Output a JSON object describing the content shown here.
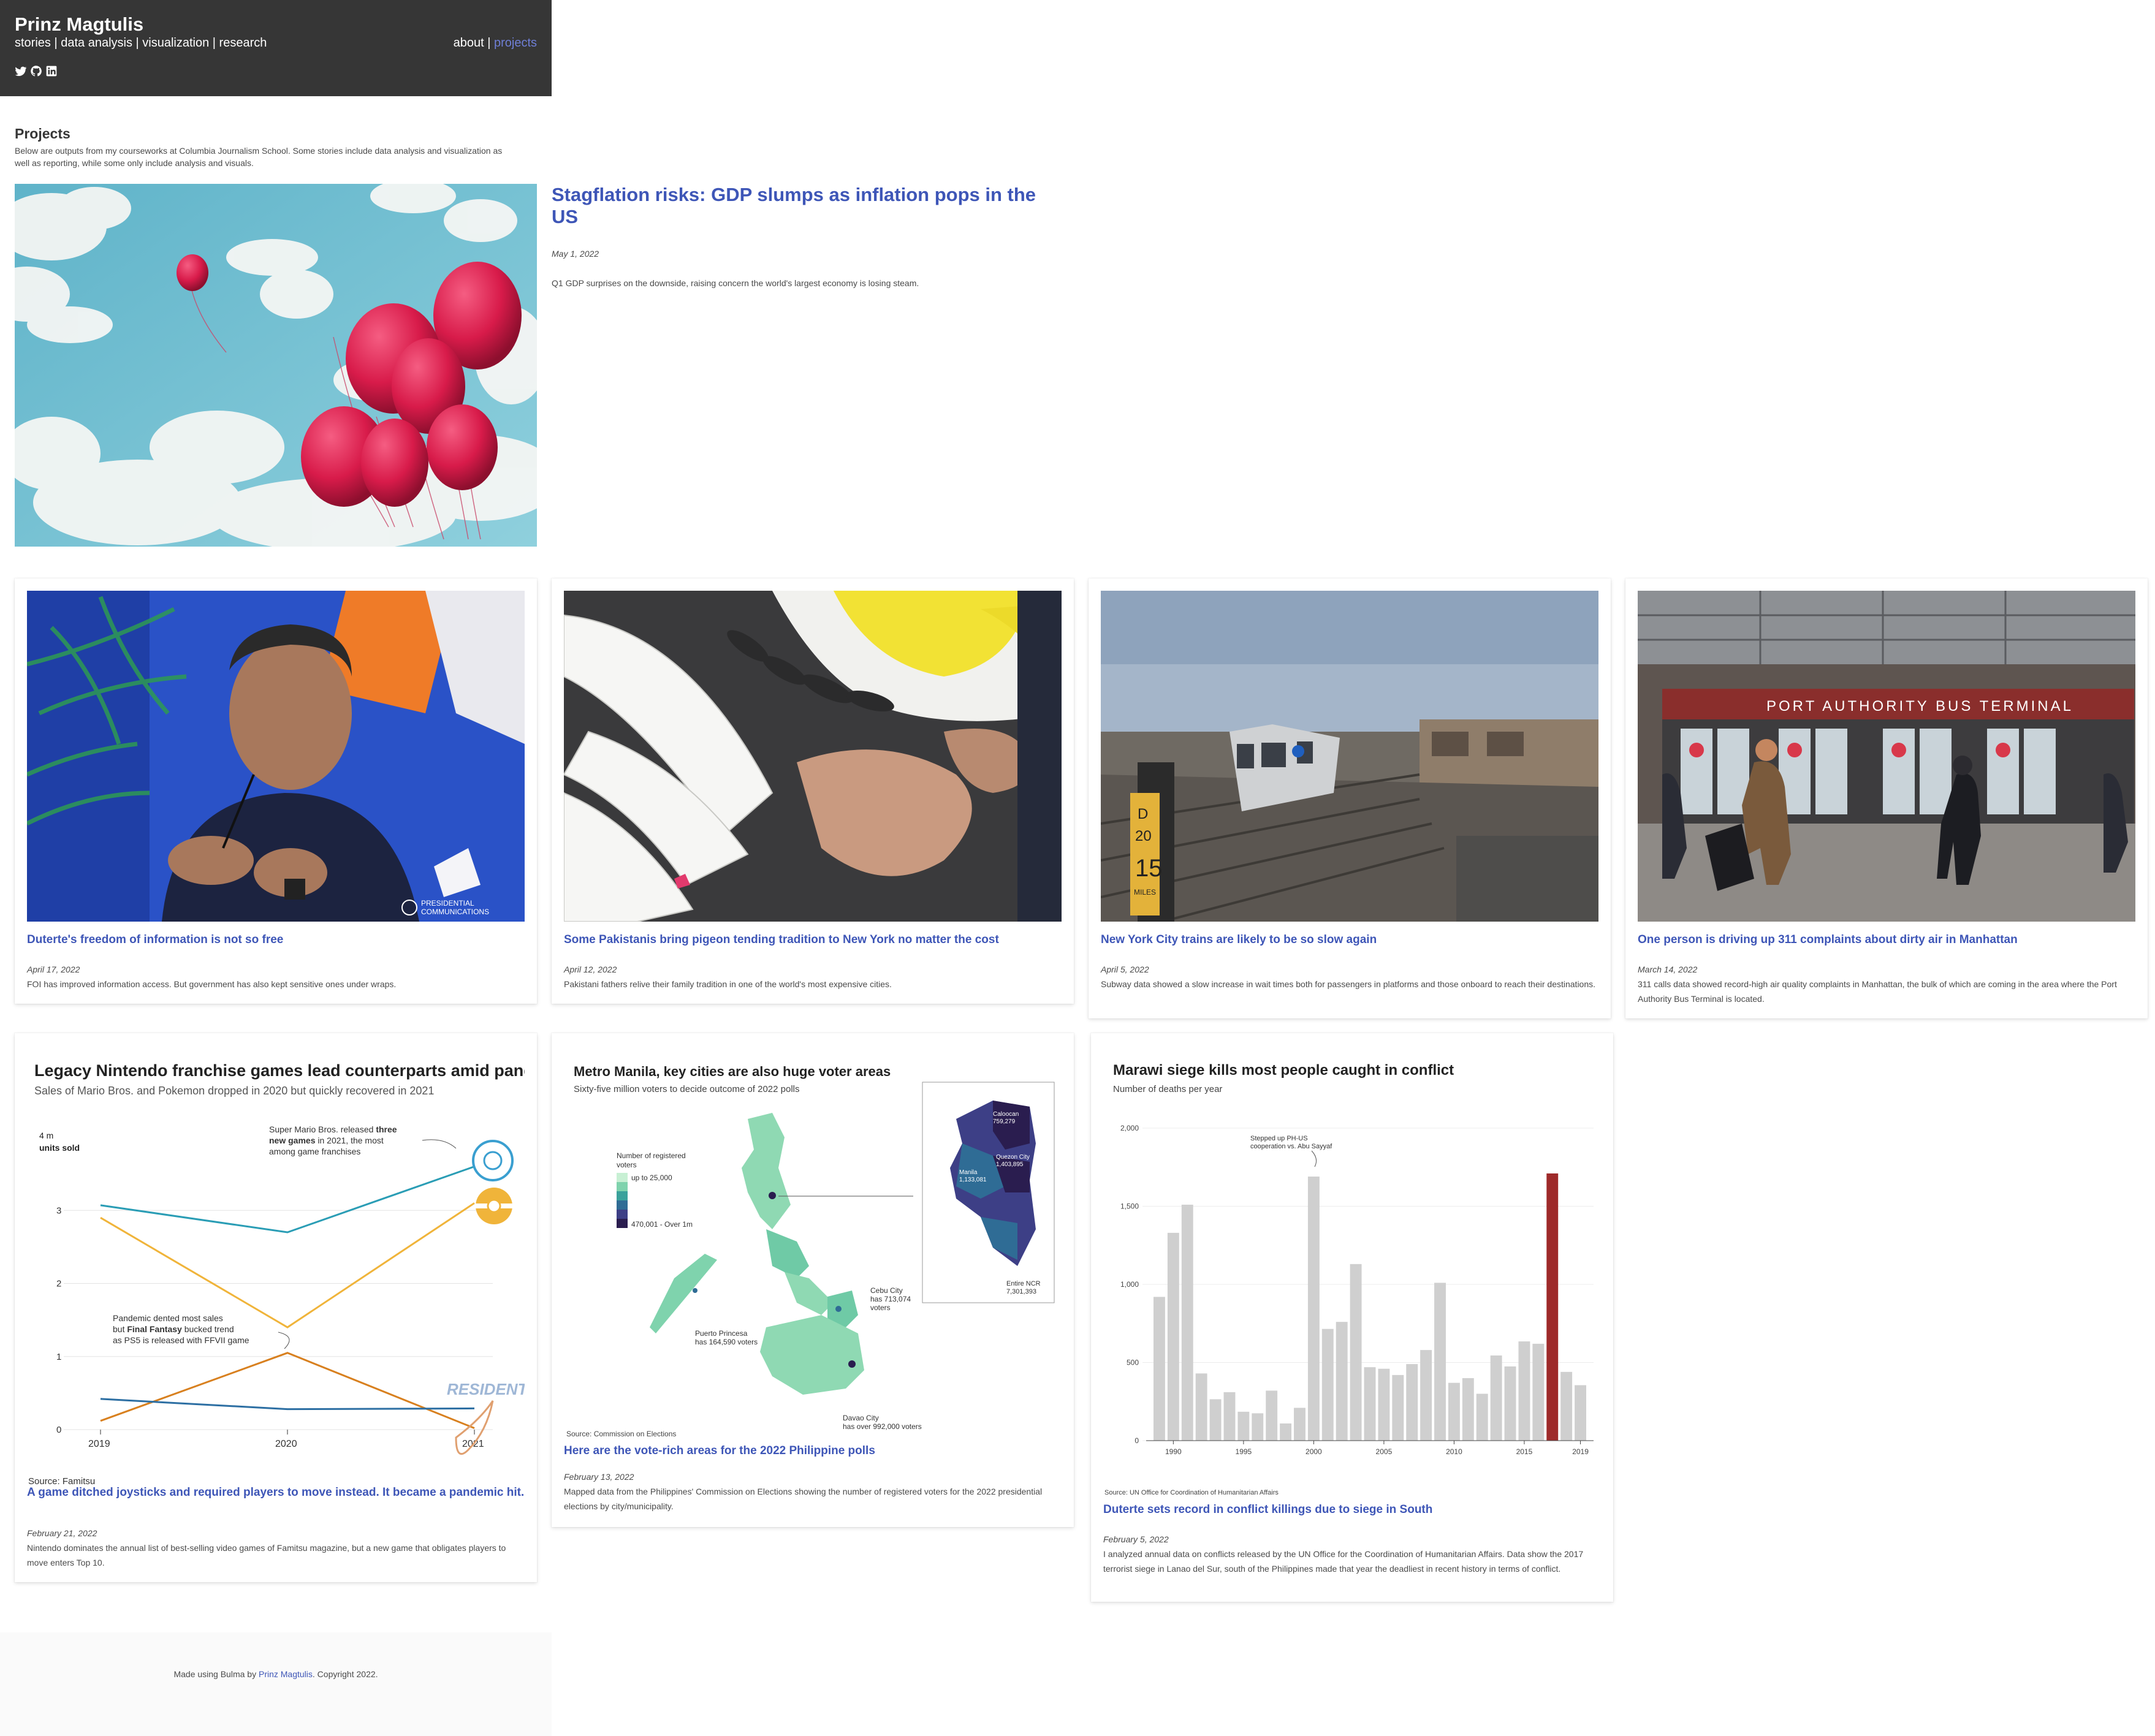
{
  "header": {
    "site_title": "Prinz Magtulis",
    "nav": [
      "stories",
      "data analysis",
      "visualization",
      "research"
    ],
    "top_nav": {
      "about": "about",
      "sep": "|",
      "projects": "projects"
    },
    "social_icons": [
      "twitter-icon",
      "github-icon",
      "linkedin-icon"
    ]
  },
  "projects": {
    "title": "Projects",
    "description": "Below are outputs from my courseworks at Columbia Journalism School. Some stories include data analysis and visualization as well as reporting, while some only include analysis and visuals."
  },
  "featured": {
    "title": "Stagflation risks: GDP slumps as inflation pops in the US",
    "date": "May 1, 2022",
    "description": "Q1 GDP surprises on the downside, raising concern the world's largest economy is losing steam."
  },
  "cards_row1": [
    {
      "title": "Duterte's freedom of information is not so free",
      "date": "April 17, 2022",
      "description": "FOI has improved information access. But government has also kept sensitive ones under wraps.",
      "watermark": "PRESIDENTIAL COMMUNICATIONS"
    },
    {
      "title": "Some Pakistanis bring pigeon tending tradition to New York no matter the cost",
      "date": "April 12, 2022",
      "description": "Pakistani fathers relive their family tradition in one of the world's most expensive cities."
    },
    {
      "title": "New York City trains are likely to be so slow again",
      "date": "April 5, 2022",
      "description": "Subway data showed a slow increase in wait times both for passengers in platforms and those onboard to reach their destinations.",
      "sign_text": [
        "D",
        "20",
        "15",
        "MILES"
      ]
    },
    {
      "title": "One person is driving up 311 complaints about dirty air in Manhattan",
      "date": "March 14, 2022",
      "description": "311 calls data showed record-high air quality complaints in Manhattan, the bulk of which are coming in the area where the Port Authority Bus Terminal is located.",
      "sign_text": "PORT AUTHORITY BUS TERMINAL"
    }
  ],
  "cards_row2": [
    {
      "title": "A game ditched joysticks and required players to move instead. It became a pandemic hit.",
      "date": "February 21, 2022",
      "description": "Nintendo dominates the annual list of best-selling video games of Famitsu magazine, but a new game that obligates players to move enters Top 10."
    },
    {
      "title": "Here are the vote-rich areas for the 2022 Philippine polls",
      "date": "February 13, 2022",
      "description": "Mapped data from the Philippines' Commission on Elections showing the number of registered voters for the 2022 presidential elections by city/municipality."
    },
    {
      "title": "Duterte sets record in conflict killings due to siege in South",
      "date": "February 5, 2022",
      "description": "I analyzed annual data on conflicts released by the UN Office for the Coordination of Humanitarian Affairs. Data show the 2017 terrorist siege in Lanao del Sur, south of the Philippines made that year the deadliest in recent history in terms of conflict."
    }
  ],
  "nintendo_chart": {
    "title": "Legacy Nintendo franchise games lead counterparts amid pandemic",
    "subtitle": "Sales of Mario Bros. and Pokemon dropped in 2020 but quickly recovered in 2021",
    "y_unit_line1": "4 m",
    "y_unit_line2": "units sold",
    "annotation1": [
      "Super Mario Bros. released ",
      "three",
      "new games",
      " in 2021, the most",
      "among game franchises"
    ],
    "annotation2": [
      "Pandemic dented most sales",
      "but ",
      "Final Fantasy",
      " bucked trend",
      "as PS5 is released with FFVII game"
    ],
    "source": "Source: Famitsu",
    "logo_text": "RESIDENT EVIL"
  },
  "map_chart": {
    "title": "Metro Manila, key cities are also huge voter areas",
    "subtitle": "Sixty-five million voters to decide outcome of 2022 polls",
    "legend_title": [
      "Number of registered",
      "voters"
    ],
    "legend_low": "up to 25,000",
    "legend_high": "470,001 - Over 1m",
    "labels": {
      "cebu": [
        "Cebu City",
        "has 713,074",
        "voters"
      ],
      "puerto": [
        "Puerto Princesa",
        "has 164,590 voters"
      ],
      "davao": [
        "Davao City",
        "has over 992,000 voters"
      ],
      "caloocan": [
        "Caloocan",
        "759,279"
      ],
      "quezon": [
        "Quezon City",
        "1,403,895"
      ],
      "manila": [
        "Manila",
        "1,133,081"
      ],
      "ncr": [
        "Entire NCR",
        "7,301,393"
      ]
    },
    "source": "Source: Commission on Elections"
  },
  "chart_data": [
    {
      "type": "line",
      "x": [
        "2019",
        "2020",
        "2021"
      ],
      "ylim": [
        0,
        4
      ],
      "yticks": [
        "0",
        "1",
        "2",
        "3"
      ],
      "series": [
        {
          "color": "#2a9db5",
          "values": [
            3.07,
            2.7,
            3.6
          ]
        },
        {
          "color": "#f0b43a",
          "values": [
            2.9,
            1.4,
            3.1
          ]
        },
        {
          "color": "#d8801f",
          "values": [
            0.12,
            1.05,
            0.02
          ]
        },
        {
          "color": "#2d6fa3",
          "values": [
            0.42,
            0.28,
            0.29
          ]
        }
      ]
    },
    {
      "type": "bar",
      "title": "Marawi siege kills most people caught in conflict",
      "subtitle": "Number of deaths per year",
      "categories": [
        "1989",
        "1990",
        "1991",
        "1992",
        "1993",
        "1994",
        "1995",
        "1996",
        "1997",
        "1998",
        "1999",
        "2000",
        "2001",
        "2002",
        "2003",
        "2004",
        "2005",
        "2006",
        "2007",
        "2008",
        "2009",
        "2010",
        "2011",
        "2012",
        "2013",
        "2014",
        "2015",
        "2016",
        "2017",
        "2018",
        "2019"
      ],
      "values": [
        920,
        1330,
        1510,
        430,
        265,
        310,
        185,
        175,
        320,
        110,
        210,
        1690,
        715,
        760,
        1130,
        470,
        460,
        420,
        490,
        580,
        1010,
        370,
        400,
        300,
        545,
        475,
        635,
        620,
        1710,
        440,
        355
      ],
      "highlight": "2017",
      "highlight_color": "#9e2a2a",
      "bar_color": "#cfcfcf",
      "yticks": [
        "0",
        "500",
        "1,000",
        "1,500",
        "2,000"
      ],
      "xticks": [
        "1990",
        "1995",
        "2000",
        "2005",
        "2010",
        "2015",
        "2019"
      ],
      "ylim": [
        0,
        2000
      ],
      "annotation": [
        "Stepped up PH-US",
        "cooperation vs. Abu Sayyaf"
      ],
      "source": "Source: UN Office for Coordination of Humanitarian Affairs"
    }
  ],
  "footer": {
    "prefix": "Made using Bulma by ",
    "author": "Prinz Magtulis",
    "suffix": ". Copyright 2022."
  }
}
